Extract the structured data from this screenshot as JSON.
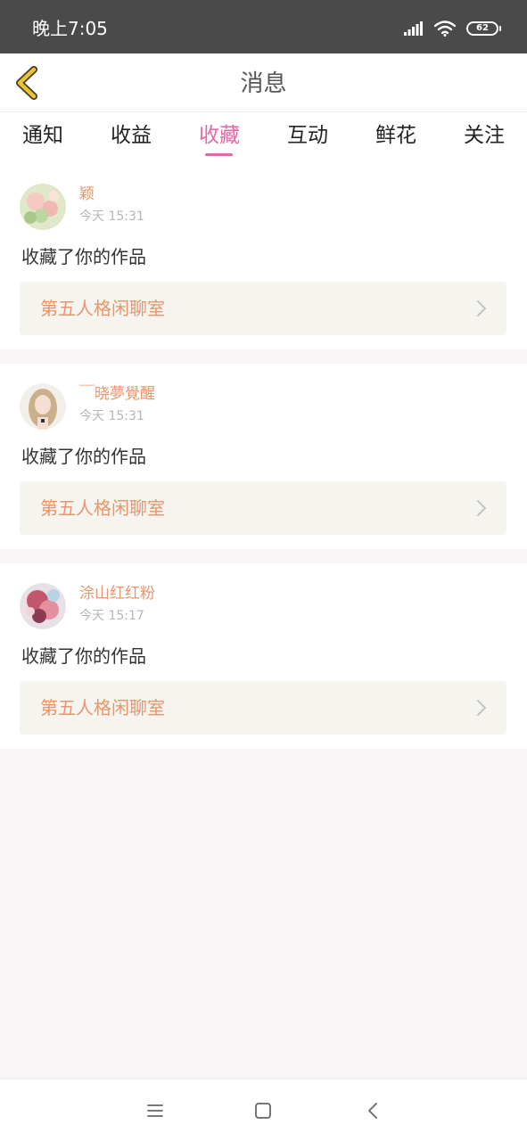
{
  "status_bar": {
    "time": "晚上7:05",
    "battery": "62",
    "icons": [
      "signal-icon",
      "wifi-icon",
      "battery-icon"
    ]
  },
  "nav": {
    "title": "消息",
    "back_icon": "chevron-left-icon",
    "accent_color": "#e8c23a"
  },
  "tabs": [
    {
      "label": "通知",
      "active": false
    },
    {
      "label": "收益",
      "active": false
    },
    {
      "label": "收藏",
      "active": true
    },
    {
      "label": "互动",
      "active": false
    },
    {
      "label": "鲜花",
      "active": false
    },
    {
      "label": "关注",
      "active": false
    }
  ],
  "colors": {
    "active_tab": "#e06aa4",
    "username": "#e8956a",
    "link_bg": "#f5f4ee"
  },
  "messages": [
    {
      "username": "颖",
      "time": "今天 15:31",
      "action": "收藏了你的作品",
      "work_title": "第五人格闲聊室"
    },
    {
      "username": "￣晓夢覺醒",
      "time": "今天 15:31",
      "action": "收藏了你的作品",
      "work_title": "第五人格闲聊室"
    },
    {
      "username": "涂山红红粉",
      "time": "今天 15:17",
      "action": "收藏了你的作品",
      "work_title": "第五人格闲聊室"
    }
  ],
  "system_nav": [
    "menu-icon",
    "home-icon",
    "back-icon"
  ]
}
